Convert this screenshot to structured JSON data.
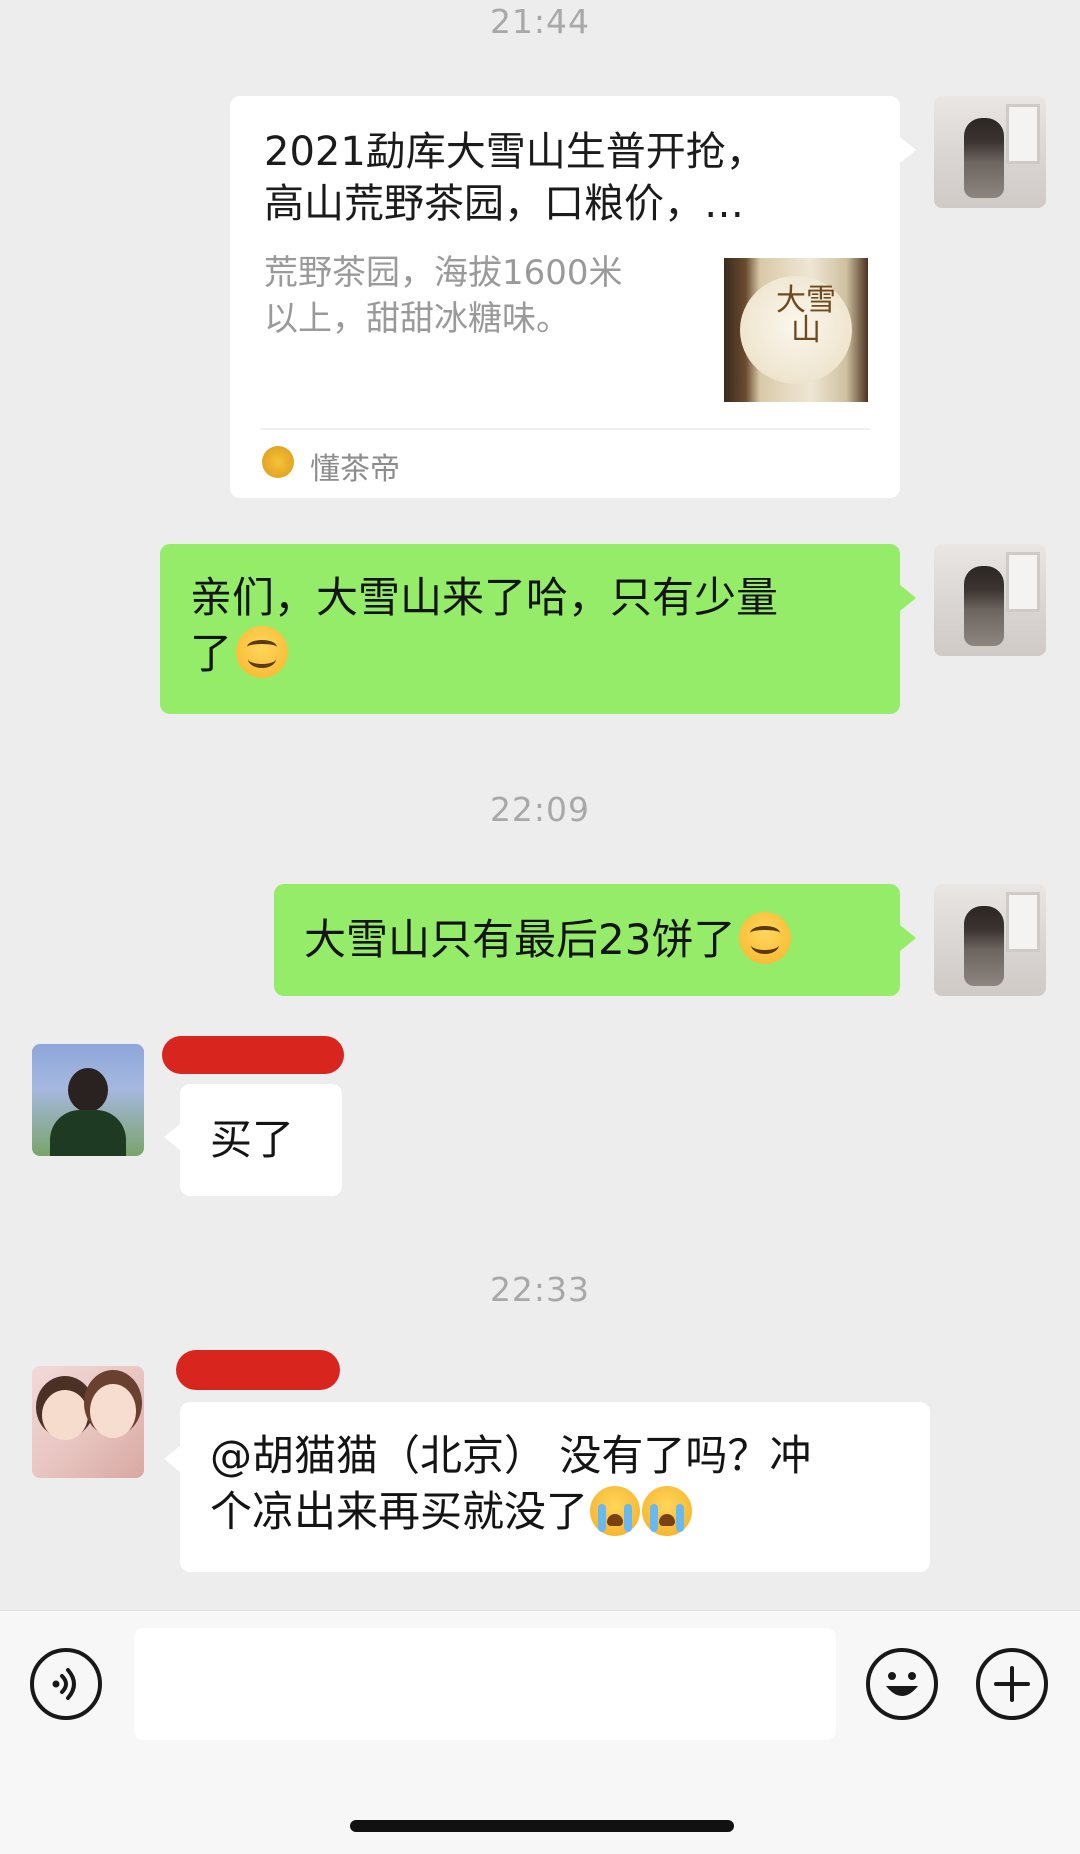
{
  "timestamps": [
    "21:44",
    "22:09",
    "22:33"
  ],
  "link_card": {
    "title_line1": "2021勐库大雪山生普开抢，",
    "title_line2": "高山荒野茶园，口粮价，…",
    "desc_line1": "荒野茶园，海拔1600米",
    "desc_line2": "以上，甜甜冰糖味。",
    "thumb_seal": "大雪山",
    "source": "懂茶帝"
  },
  "messages": {
    "self_1_line1": "亲们，大雪山来了哈，只有少量",
    "self_1_line2": "了",
    "self_2": "大雪山只有最后23饼了",
    "other_1": "买了",
    "other_2_line1": "@胡猫猫（北京） 没有了吗？冲",
    "other_2_line2": "个凉出来再买就没了"
  },
  "icons": {
    "voice": "voice-icon",
    "emoji": "emoji-icon",
    "plus": "plus-icon",
    "smile": "smile-emoji-icon",
    "cry": "crying-emoji-icon"
  },
  "colors": {
    "background": "#ededed",
    "self_bubble": "#95ec69",
    "other_bubble": "#ffffff",
    "redaction": "#d8261f"
  }
}
